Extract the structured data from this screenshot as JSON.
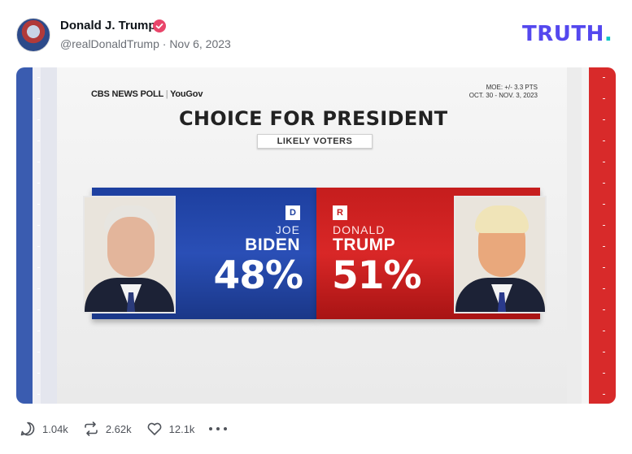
{
  "post": {
    "author_name": "Donald J. Trump",
    "handle": "@realDonaldTrump",
    "separator": "·",
    "date": "Nov 6, 2023",
    "verified": true
  },
  "brand": {
    "logo_text": "TRUTH",
    "logo_dot": ".",
    "logo_color": "#5448EE",
    "dot_color": "#0EC5C5"
  },
  "graphic": {
    "source": "CBS NEWS POLL",
    "source_sep": "|",
    "partner": "YouGov",
    "moe": "MOE: +/- 3.3 PTS",
    "dates": "OCT. 30 - NOV. 3, 2023",
    "headline": "CHOICE FOR PRESIDENT",
    "subheadline": "LIKELY VOTERS",
    "candidates": [
      {
        "party": "D",
        "first": "JOE",
        "last": "BIDEN",
        "percent": "48%",
        "color": "#1D3F9F"
      },
      {
        "party": "R",
        "first": "DONALD",
        "last": "TRUMP",
        "percent": "51%",
        "color": "#C51D1D"
      }
    ]
  },
  "actions": {
    "replies": "1.04k",
    "retruths": "2.62k",
    "likes": "12.1k"
  },
  "icons": [
    "verified-badge-icon",
    "reply-icon",
    "retruth-icon",
    "like-icon",
    "more-icon"
  ]
}
